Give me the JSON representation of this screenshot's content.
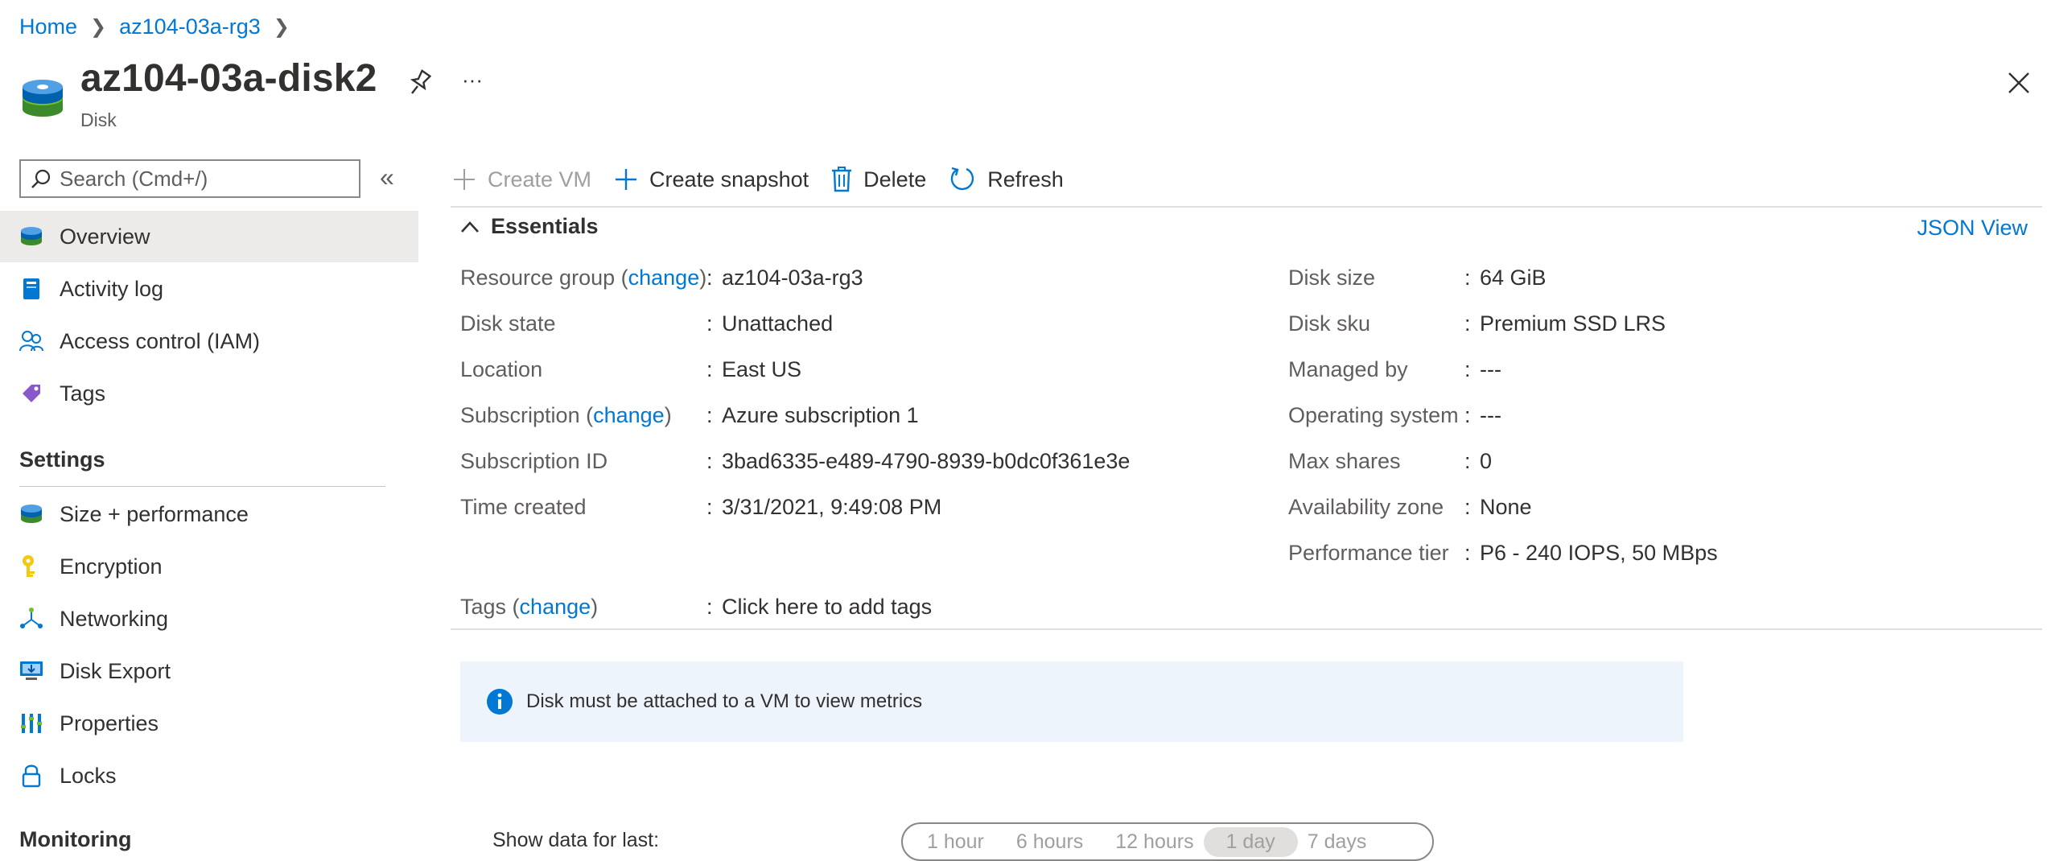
{
  "breadcrumb": [
    {
      "label": "Home"
    },
    {
      "label": "az104-03a-rg3"
    }
  ],
  "header": {
    "title": "az104-03a-disk2",
    "subtitle": "Disk",
    "more_label": "···"
  },
  "search": {
    "placeholder": "Search (Cmd+/)"
  },
  "nav": {
    "top": [
      {
        "label": "Overview",
        "icon": "disk-icon",
        "selected": true
      },
      {
        "label": "Activity log",
        "icon": "activity-log-icon"
      },
      {
        "label": "Access control (IAM)",
        "icon": "iam-icon"
      },
      {
        "label": "Tags",
        "icon": "tag-icon"
      }
    ],
    "settings_heading": "Settings",
    "settings": [
      {
        "label": "Size + performance",
        "icon": "disk-icon"
      },
      {
        "label": "Encryption",
        "icon": "key-icon"
      },
      {
        "label": "Networking",
        "icon": "network-icon"
      },
      {
        "label": "Disk Export",
        "icon": "export-icon"
      },
      {
        "label": "Properties",
        "icon": "properties-icon"
      },
      {
        "label": "Locks",
        "icon": "lock-icon"
      }
    ],
    "monitoring_heading": "Monitoring"
  },
  "toolbar": {
    "create_vm": "Create VM",
    "create_snapshot": "Create snapshot",
    "delete": "Delete",
    "refresh": "Refresh"
  },
  "essentials": {
    "heading": "Essentials",
    "json_view": "JSON View",
    "change": "change",
    "left": {
      "resource_group_label": "Resource group",
      "resource_group_value": "az104-03a-rg3",
      "disk_state_label": "Disk state",
      "disk_state_value": "Unattached",
      "location_label": "Location",
      "location_value": "East US",
      "subscription_label": "Subscription",
      "subscription_value": "Azure subscription 1",
      "subscription_id_label": "Subscription ID",
      "subscription_id_value": "3bad6335-e489-4790-8939-b0dc0f361e3e",
      "time_created_label": "Time created",
      "time_created_value": "3/31/2021, 9:49:08 PM"
    },
    "right": {
      "disk_size_label": "Disk size",
      "disk_size_value": "64 GiB",
      "disk_sku_label": "Disk sku",
      "disk_sku_value": "Premium SSD LRS",
      "managed_by_label": "Managed by",
      "managed_by_value": "---",
      "os_label": "Operating system",
      "os_value": "---",
      "max_shares_label": "Max shares",
      "max_shares_value": "0",
      "availability_zone_label": "Availability zone",
      "availability_zone_value": "None",
      "performance_tier_label": "Performance tier",
      "performance_tier_value": "P6 - 240 IOPS, 50 MBps"
    },
    "tags_label": "Tags",
    "tags_value": "Click here to add tags"
  },
  "banner": {
    "text": "Disk must be attached to a VM to view metrics"
  },
  "metrics": {
    "show_label": "Show data for last:",
    "ranges": [
      "1 hour",
      "6 hours",
      "12 hours",
      "1 day",
      "7 days"
    ],
    "selected": "1 day"
  },
  "colors": {
    "accent": "#0078d4",
    "selected_bg": "#edebe9",
    "banner_bg": "#eef4fb"
  }
}
